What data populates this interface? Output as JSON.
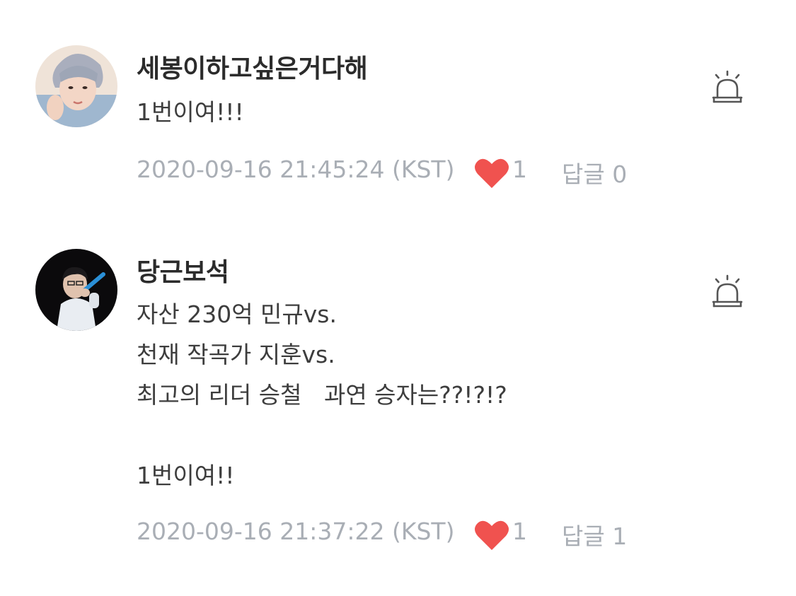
{
  "comments": [
    {
      "author": "세봉이하고싶은거다해",
      "body": "1번이여!!!",
      "timestamp": "2020-09-16 21:45:24 (KST)",
      "likes": "1",
      "reply": "답글 0",
      "avatar_icon": "user-avatar-photo",
      "report_icon": "siren-report-icon",
      "like_icon": "heart-icon"
    },
    {
      "author": "당근보석",
      "body": "자산 230억 민규vs.\n천재 작곡가 지훈vs.\n최고의 리더 승철   과연 승자는??!?!?\n\n1번이여!!",
      "timestamp": "2020-09-16 21:37:22 (KST)",
      "likes": "1",
      "reply": "답글 1",
      "avatar_icon": "user-avatar-photo",
      "report_icon": "siren-report-icon",
      "like_icon": "heart-icon"
    }
  ],
  "colors": {
    "heart": "#f0524f",
    "meta_text": "#a9aeb5",
    "author_text": "#2b2b2b",
    "body_text": "#3d3d3d",
    "icon_stroke": "#555555"
  }
}
